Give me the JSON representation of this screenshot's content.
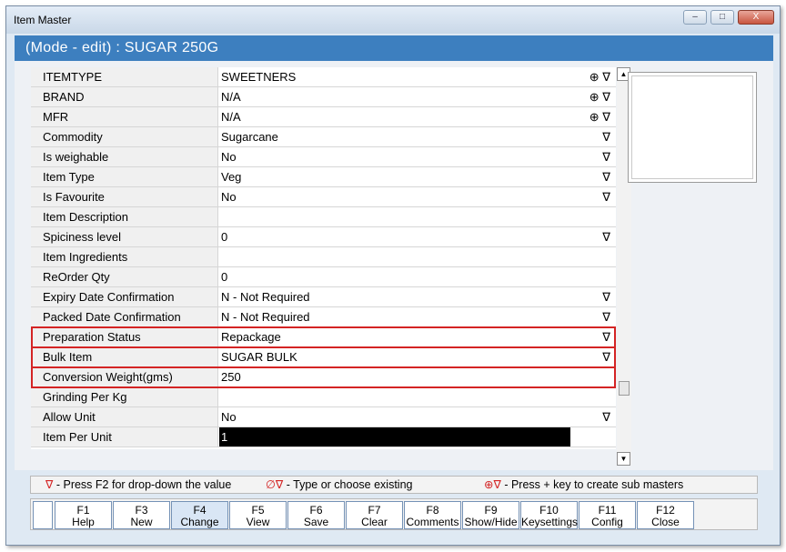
{
  "window": {
    "title": "Item Master",
    "controls": [
      "–",
      "□",
      "X"
    ]
  },
  "header": {
    "text": "(Mode - edit)  :  SUGAR 250G"
  },
  "grid": {
    "rows": [
      {
        "label": "ITEMTYPE",
        "value": "SWEETNERS",
        "icons": "⊕ ∇"
      },
      {
        "label": "BRAND",
        "value": "N/A",
        "icons": "⊕ ∇"
      },
      {
        "label": "MFR",
        "value": "N/A",
        "icons": "⊕ ∇"
      },
      {
        "label": "Commodity",
        "value": "Sugarcane",
        "icons": "∇"
      },
      {
        "label": "Is weighable",
        "value": "No",
        "icons": "∇"
      },
      {
        "label": "Item Type",
        "value": "Veg",
        "icons": "∇"
      },
      {
        "label": "Is Favourite",
        "value": "No",
        "icons": "∇"
      },
      {
        "label": "Item Description",
        "value": "",
        "icons": ""
      },
      {
        "label": "Spiciness level",
        "value": "0",
        "icons": "∇"
      },
      {
        "label": "Item Ingredients",
        "value": "",
        "icons": ""
      },
      {
        "label": "ReOrder Qty",
        "value": "0",
        "icons": ""
      },
      {
        "label": "Expiry Date Confirmation",
        "value": "N - Not Required",
        "icons": "∇"
      },
      {
        "label": "Packed Date Confirmation",
        "value": "N - Not Required",
        "icons": "∇"
      },
      {
        "label": "Preparation Status",
        "value": "Repackage",
        "icons": "∇"
      },
      {
        "label": "Bulk Item",
        "value": "SUGAR BULK",
        "icons": "∇"
      },
      {
        "label": "Conversion Weight(gms)",
        "value": "250",
        "icons": ""
      },
      {
        "label": "Grinding Per Kg",
        "value": "",
        "icons": ""
      },
      {
        "label": "Allow Unit",
        "value": "No",
        "icons": "∇"
      },
      {
        "label": "Item Per Unit",
        "value": "1",
        "icons": ""
      }
    ]
  },
  "scrollbar": {
    "up": "▲",
    "down": "▼"
  },
  "legend": {
    "dropdown_symbol": "∇",
    "dropdown_text": " - Press F2 for drop-down the value",
    "choose_symbol": "∅∇",
    "choose_text": " - Type or choose existing",
    "submaster_symbol": "⊕∇",
    "submaster_text": " - Press + key to create sub masters"
  },
  "fkeys": [
    {
      "key": "F1",
      "label": "Help"
    },
    {
      "key": "F3",
      "label": "New"
    },
    {
      "key": "F4",
      "label": "Change"
    },
    {
      "key": "F5",
      "label": "View"
    },
    {
      "key": "F6",
      "label": "Save"
    },
    {
      "key": "F7",
      "label": "Clear"
    },
    {
      "key": "F8",
      "label": "Comments"
    },
    {
      "key": "F9",
      "label": "Show/Hide"
    },
    {
      "key": "F10",
      "label": "Keysettings"
    },
    {
      "key": "F11",
      "label": "Config"
    },
    {
      "key": "F12",
      "label": "Close"
    }
  ],
  "colors": {
    "header_bg": "#3d7fbf",
    "highlight": "#d42424",
    "legend_symbol": "#d42424"
  }
}
